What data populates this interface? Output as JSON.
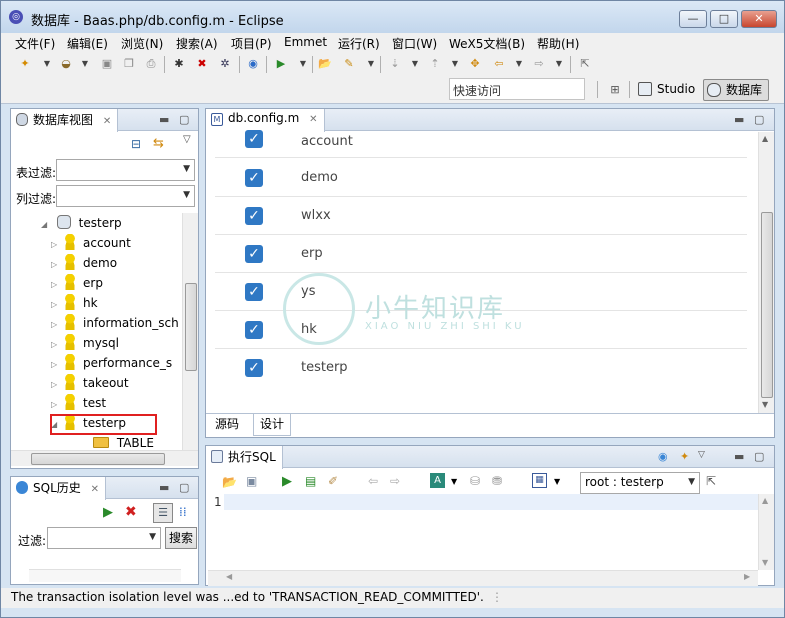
{
  "window": {
    "title": "数据库 - Baas.php/db.config.m - Eclipse",
    "controls": {
      "minimize": "—",
      "maximize": "□",
      "close": "✕"
    }
  },
  "menu": [
    "文件(F)",
    "编辑(E)",
    "浏览(N)",
    "搜索(A)",
    "项目(P)",
    "Emmet",
    "运行(R)",
    "窗口(W)",
    "WeX5文档(B)",
    "帮助(H)"
  ],
  "toolbar": {
    "quick_access": "快速访问",
    "perspectives": [
      {
        "label": "Studio",
        "active": false
      },
      {
        "label": "数据库",
        "active": true
      }
    ]
  },
  "db_view": {
    "tab_label": "数据库视图",
    "table_filter_label": "表过滤:",
    "column_filter_label": "列过滤:",
    "root": "testerp",
    "items": [
      "account",
      "demo",
      "erp",
      "hk",
      "information_sch",
      "mysql",
      "performance_s",
      "takeout",
      "test",
      "testerp"
    ],
    "highlighted_item": "testerp",
    "child": "TABLE"
  },
  "editor": {
    "tab_label": "db.config.m",
    "rows": [
      {
        "label": "account",
        "checked": true
      },
      {
        "label": "demo",
        "checked": true
      },
      {
        "label": "wlxx",
        "checked": true
      },
      {
        "label": "erp",
        "checked": true
      },
      {
        "label": "ys",
        "checked": true
      },
      {
        "label": "hk",
        "checked": true
      },
      {
        "label": "testerp",
        "checked": true
      }
    ],
    "bottom_tabs": [
      "源码",
      "设计"
    ],
    "active_bottom_tab": "设计"
  },
  "watermark": {
    "main": "小牛知识库",
    "sub": "XIAO NIU ZHI SHI KU"
  },
  "sql_history": {
    "tab_label": "SQL历史",
    "filter_label": "过滤:",
    "search_button": "搜索"
  },
  "exec_sql": {
    "tab_label": "执行SQL",
    "connection": "root : testerp",
    "line_number": "1"
  },
  "status": {
    "message": "The transaction isolation level was ...ed to 'TRANSACTION_READ_COMMITTED'."
  },
  "colors": {
    "window_frame": "#d6e4f2",
    "checkbox": "#2f78c4",
    "highlight_box": "#e02020",
    "watermark": "#bfe0df"
  }
}
